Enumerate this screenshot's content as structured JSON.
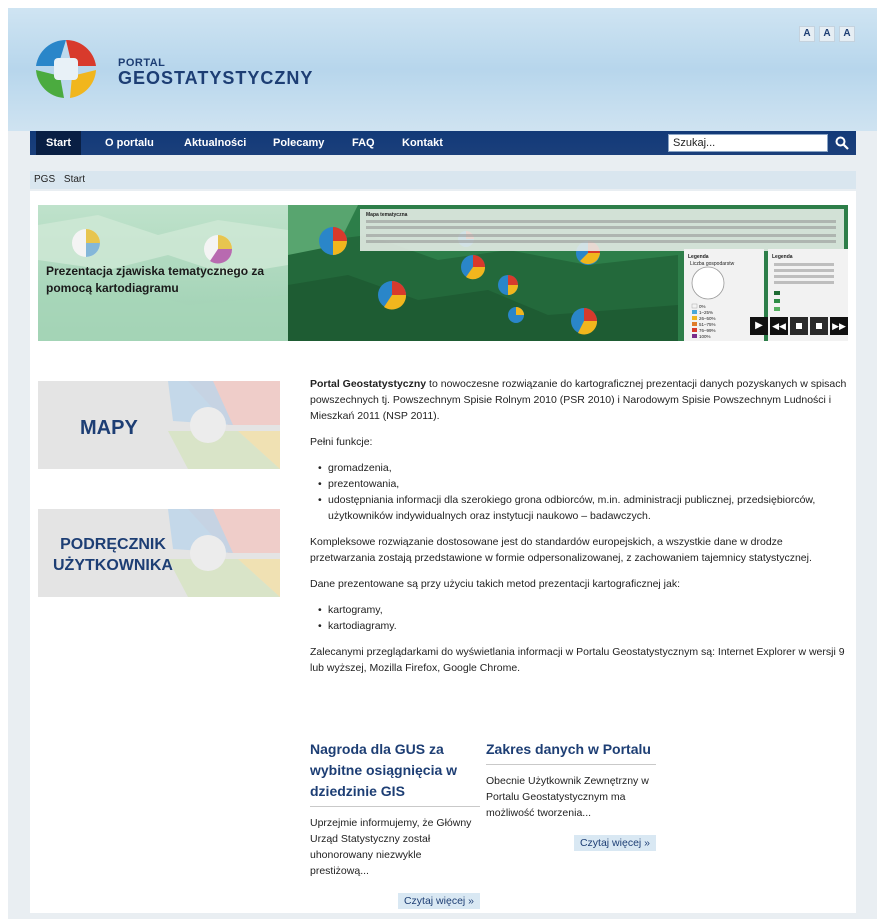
{
  "header": {
    "portal_line1": "PORTAL",
    "portal_line2": "GEOSTATYSTYCZNY",
    "font_size_buttons": [
      "A",
      "A",
      "A"
    ]
  },
  "nav": {
    "items": [
      {
        "label": "Start",
        "active": true
      },
      {
        "label": "O portalu"
      },
      {
        "label": "Aktualności"
      },
      {
        "label": "Polecamy"
      },
      {
        "label": "FAQ"
      },
      {
        "label": "Kontakt"
      }
    ],
    "search_value": "Szukaj..."
  },
  "breadcrumb": {
    "items": [
      "PGS",
      "Start"
    ]
  },
  "banner": {
    "caption": "Prezentacja zjawiska tematycznego za pomocą kartodiagramu",
    "panel_title": "Mapa tematyczna",
    "legend_title": "Legenda",
    "legend_subtitle": "Liczba gospodarstw",
    "legend_ranges": [
      "0%",
      "1–25%",
      "26–50%",
      "51–75%",
      "76–99%",
      "100%"
    ]
  },
  "sidebar": {
    "maps_label": "MAPY",
    "manual_label_line1": "PODRĘCZNIK",
    "manual_label_line2": "UŻYTKOWNIKA"
  },
  "main": {
    "intro_bold": "Portal Geostatystyczny",
    "intro_rest": " to nowoczesne rozwiązanie do kartograficznej prezentacji danych pozyskanych w spisach powszechnych tj. Powszechnym Spisie Rolnym 2010 (PSR 2010) i Narodowym Spisie Powszechnym Ludności i Mieszkań 2011 (NSP 2011).",
    "functions_heading": "Pełni funkcje:",
    "functions": [
      "gromadzenia,",
      "prezentowania,",
      "udostępniania informacji dla szerokiego grona odbiorców, m.in. administracji publicznej, przedsiębiorców, użytkowników indywidualnych oraz instytucji naukowo – badawczych."
    ],
    "standards_text": "Kompleksowe rozwiązanie dostosowane jest do standardów europejskich, a wszystkie dane w drodze przetwarzania zostają przedstawione w formie odpersonalizowanej, z zachowaniem tajemnicy statystycznej.",
    "methods_heading": "Dane prezentowane są przy użyciu takich metod prezentacji kartograficznej jak:",
    "methods": [
      "kartogramy,",
      "kartodiagramy."
    ],
    "browsers_text": "Zalecanymi przeglądarkami do wyświetlania informacji w Portalu Geostatystycznym są: Internet Explorer w wersji 9 lub wyższej, Mozilla Firefox, Google Chrome."
  },
  "news": [
    {
      "title": "Nagroda dla GUS za wybitne osiągnięcia w dziedzinie GIS",
      "body": "Uprzejmie informujemy, że Główny Urząd Statystyczny został uhonorowany niezwykle prestiżową...",
      "link": "Czytaj więcej »"
    },
    {
      "title": "Zakres danych w Portalu",
      "body": "Obecnie Użytkownik Zewnętrzny w Portalu Geostatystycznym ma możliwość tworzenia...",
      "link": "Czytaj więcej »"
    }
  ],
  "colors": {
    "nav_bg": "#1b3f7b",
    "brand_blue": "#1d3e74",
    "map_green": "#2b7a46"
  }
}
